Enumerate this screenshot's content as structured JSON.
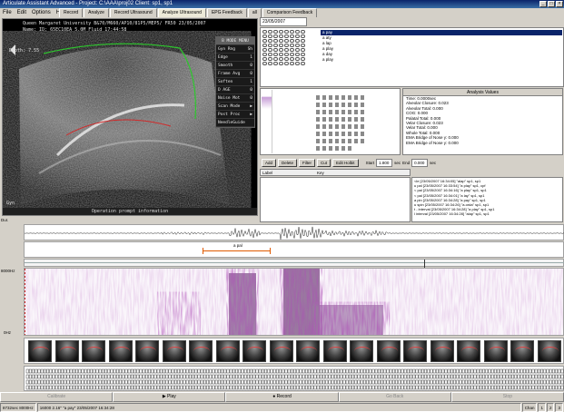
{
  "window": {
    "title": "Articulate Assistant Advanced - Project: C:\\AAA\\proj02     Client: sp1, sp1"
  },
  "menu": [
    "File",
    "Edit",
    "Options",
    "Help"
  ],
  "tabs": [
    "Record",
    "Analyze",
    "Record Ultrasound",
    "Analyze Ultrasound",
    "EPG Feedback",
    "all",
    "Comparison Feedback"
  ],
  "ultrasound": {
    "header_line1": "Queen Margaret University        B&70/M660/AP10/81P5/MEP5/ FR50    23/05/2007",
    "header_line2": "Name:            ID:              65EC10EA     5.0M     Fluid          17:44:58",
    "depth_label": "Depth: 7.55",
    "gyn_label": "Gyn",
    "footer": "Operation prompt information",
    "menu_title": "B MODE MENU",
    "menu_items": [
      {
        "label": "Gyn Rng",
        "value": "Sh"
      },
      {
        "label": "Edge",
        "value": "1"
      },
      {
        "label": "Smooth",
        "value": "0"
      },
      {
        "label": "Frame Avg",
        "value": "0"
      },
      {
        "label": "Soften",
        "value": "1"
      },
      {
        "label": "D AGE",
        "value": "0"
      },
      {
        "label": "Noise Mot",
        "value": "0"
      },
      {
        "label": "Scan Mode",
        "value": "▶"
      },
      {
        "label": "Post Proc",
        "value": "▶"
      },
      {
        "label": "NeedleGuide",
        "value": ""
      }
    ]
  },
  "epg": {
    "date": "23/05/2007",
    "list": [
      "a pay",
      "a aty",
      "a lap",
      "a play",
      "a day",
      "a play"
    ]
  },
  "analysis": {
    "title": "Analysis Values",
    "rows": [
      "Time: 0.0000sec",
      "Alveolar Closure: 0.023",
      "Alveolar Total: 0.000",
      "COG: 0.000",
      "Palatal Total: 0.000",
      "Velar Closure: 0.023",
      "Velar Total: 0.000",
      "Whole Total: 0.000",
      "EMA Bridge of Nose y: 0.000",
      "EMA Bridge of Nose y: 0.000"
    ]
  },
  "controls": {
    "buttons": [
      "Add",
      "Delete",
      "Filter",
      "Cut",
      "Edit Holbit"
    ],
    "start_label": "Start",
    "start_value": "1.800",
    "sec1": "sec",
    "end_label": "End",
    "end_value": "0.000",
    "sec2": "sec"
  },
  "labels": {
    "label_col": "Label",
    "key_col": "Key"
  },
  "textlist": [
    "<le [23/05/2007 16:34:05] \"alap\" sp1, sp1",
    "u pal [23/05/2007 16:33:54] \"a play\" sp1, cpf",
    "< pal [23/05/2007 16:34:16] \"a play\" sp1, sp1",
    "< pal [23/05/2007 16:34:01] \"a lay\" sp1, sp1",
    "a pin [23/05/2007 16:34:28] \"a pay\" sp1, sp1",
    "u spin [23/05/2007 16:34:26] \"a.orda\" sp1, sp1",
    "t - interval [23/05/2007 16:34:28] \"a play\" sp1, sp1",
    "l interval [23/05/2007 16:34:28] \"alap\" sp1, sp1"
  ],
  "signal": {
    "dur_label": "Dur.",
    "annotation_label": "a pal",
    "freq_top": "8000Hz",
    "freq_bottom": "0Hz"
  },
  "transport": [
    "Calibrate",
    "Play",
    "Record",
    "Go Back",
    "Stop"
  ],
  "status": [
    "8732sec 8000Hz",
    "16000  2.16\" \"a pay\" 23/05/2007 16:34:28",
    "Chan",
    "1",
    "2",
    "3"
  ]
}
